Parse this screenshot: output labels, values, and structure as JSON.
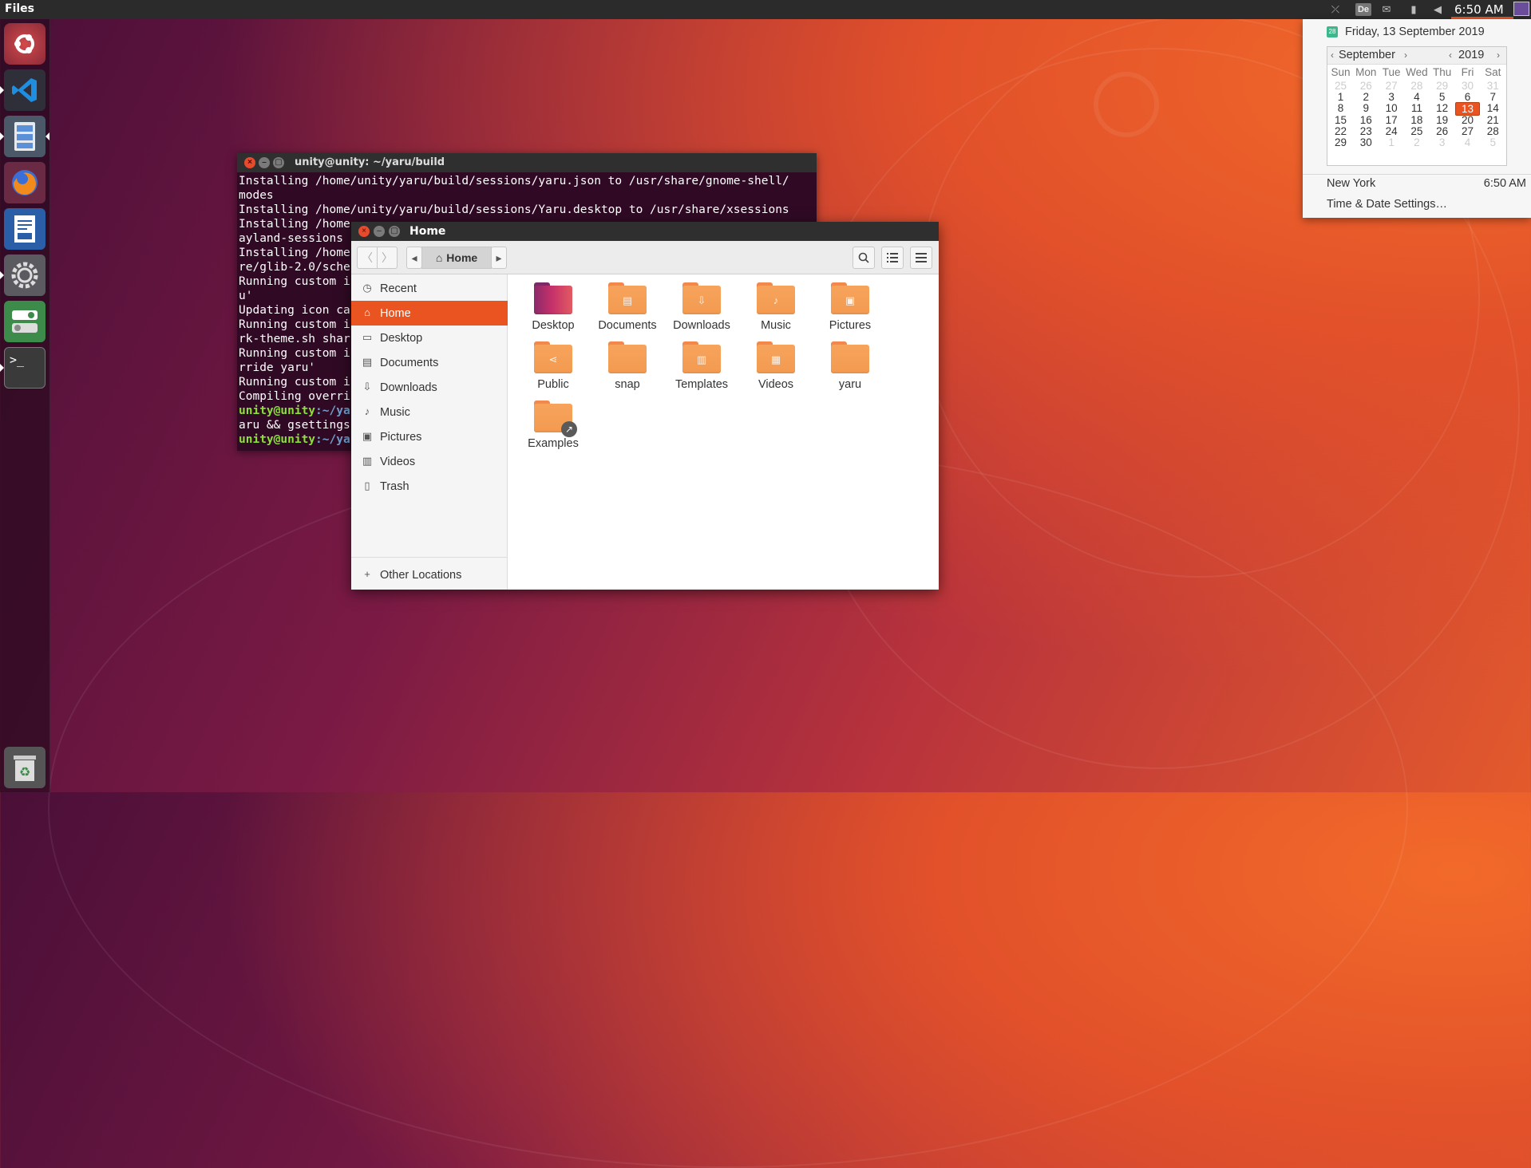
{
  "panel": {
    "app_title": "Files",
    "keyboard_label": "De",
    "clock": "6:50 AM"
  },
  "colors": {
    "accent": "#e95420",
    "panel": "#2b2b2b",
    "terminal_bg": "#300a24"
  },
  "launcher": {
    "items": [
      "ubuntu-icon",
      "vscode-icon",
      "files-icon",
      "firefox-icon",
      "writer-icon",
      "settings-icon",
      "tweaks-icon",
      "terminal-icon"
    ],
    "trash": "trash-icon"
  },
  "terminal": {
    "title": "unity@unity: ~/yaru/build",
    "lines": [
      "Installing /home/unity/yaru/build/sessions/yaru.json to /usr/share/gnome-shell/",
      "modes",
      "Installing /home/unity/yaru/build/sessions/Yaru.desktop to /usr/share/xsessions",
      "Installing /home",
      "ayland-sessions",
      "Installing /home",
      "re/glib-2.0/sche",
      "Running custom i",
      "u'",
      "Updating icon ca",
      "Running custom i",
      "rk-theme.sh shar",
      "Running custom i",
      "rride yaru'",
      "Running custom i",
      "Compiling overri"
    ],
    "prompt_user": "unity@unity",
    "prompt_path": ":~/ya",
    "command_tail": "aru && gsettings"
  },
  "files": {
    "title": "Home",
    "path_label": "Home",
    "sidebar": [
      {
        "label": "Recent",
        "icon": "clock-icon"
      },
      {
        "label": "Home",
        "icon": "home-icon"
      },
      {
        "label": "Desktop",
        "icon": "desktop-icon"
      },
      {
        "label": "Documents",
        "icon": "document-icon"
      },
      {
        "label": "Downloads",
        "icon": "download-icon"
      },
      {
        "label": "Music",
        "icon": "music-icon"
      },
      {
        "label": "Pictures",
        "icon": "picture-icon"
      },
      {
        "label": "Videos",
        "icon": "video-icon"
      },
      {
        "label": "Trash",
        "icon": "trash-icon"
      },
      {
        "label": "Other Locations",
        "icon": "plus-icon"
      }
    ],
    "active_sidebar": "Home",
    "items": [
      {
        "name": "Desktop",
        "icon": "desktop-folder-icon"
      },
      {
        "name": "Documents",
        "icon": "documents-folder-icon"
      },
      {
        "name": "Downloads",
        "icon": "downloads-folder-icon"
      },
      {
        "name": "Music",
        "icon": "music-folder-icon"
      },
      {
        "name": "Pictures",
        "icon": "pictures-folder-icon"
      },
      {
        "name": "Public",
        "icon": "public-folder-icon"
      },
      {
        "name": "snap",
        "icon": "folder-icon"
      },
      {
        "name": "Templates",
        "icon": "templates-folder-icon"
      },
      {
        "name": "Videos",
        "icon": "videos-folder-icon"
      },
      {
        "name": "yaru",
        "icon": "folder-icon"
      },
      {
        "name": "Examples",
        "icon": "link-folder-icon"
      }
    ]
  },
  "calendar": {
    "date_header": "Friday, 13 September 2019",
    "month": "September",
    "year": "2019",
    "weekdays": [
      "Sun",
      "Mon",
      "Tue",
      "Wed",
      "Thu",
      "Fri",
      "Sat"
    ],
    "weeks": [
      [
        "25",
        "26",
        "27",
        "28",
        "29",
        "30",
        "31"
      ],
      [
        "1",
        "2",
        "3",
        "4",
        "5",
        "6",
        "7"
      ],
      [
        "8",
        "9",
        "10",
        "11",
        "12",
        "13",
        "14"
      ],
      [
        "15",
        "16",
        "17",
        "18",
        "19",
        "20",
        "21"
      ],
      [
        "22",
        "23",
        "24",
        "25",
        "26",
        "27",
        "28"
      ],
      [
        "29",
        "30",
        "1",
        "2",
        "3",
        "4",
        "5"
      ]
    ],
    "today": "13",
    "city": "New York",
    "city_time": "6:50 AM",
    "settings_label": "Time & Date Settings…"
  }
}
